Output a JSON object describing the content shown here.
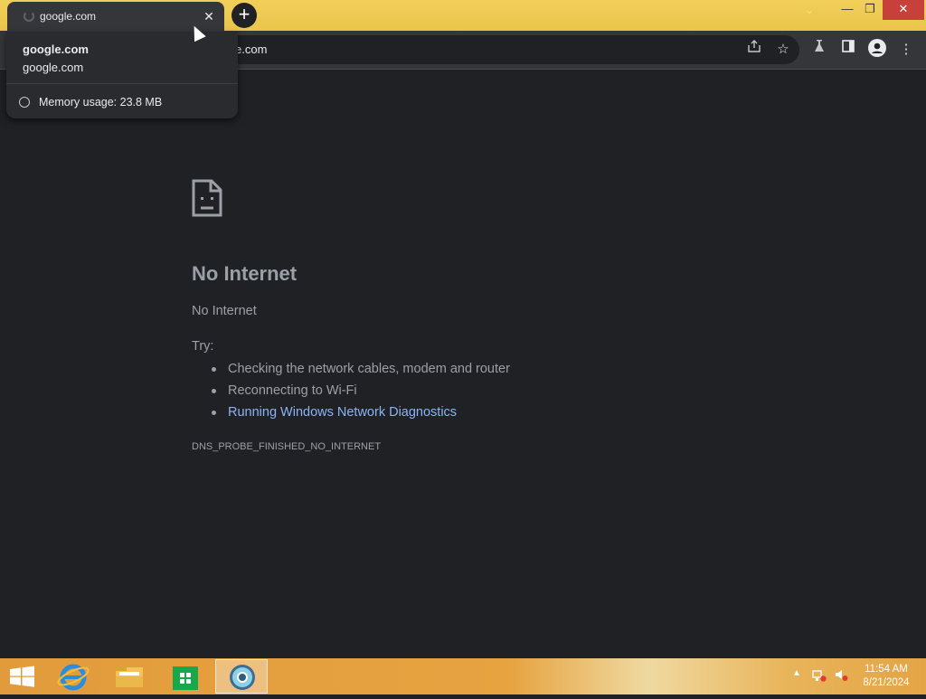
{
  "tab": {
    "title": "google.com",
    "close_label": "✕"
  },
  "newtab_label": "+",
  "window_controls": {
    "minimize": "—",
    "maximize": "❐",
    "close": "✕"
  },
  "omnibox": {
    "url_visible": "e.com"
  },
  "hovercard": {
    "title": "google.com",
    "url": "google.com",
    "memory": "Memory usage: 23.8 MB"
  },
  "toolbar_icons": [
    "share-icon",
    "star-icon",
    "extension-icon",
    "sidepanel-icon",
    "profile-icon",
    "menu-icon"
  ],
  "error_page": {
    "heading": "No Internet",
    "subtitle": "No Internet",
    "try_label": "Try:",
    "suggestions": [
      "Checking the network cables, modem and router",
      "Reconnecting to Wi-Fi",
      "Running Windows Network Diagnostics"
    ],
    "error_code": "DNS_PROBE_FINISHED_NO_INTERNET"
  },
  "taskbar": {
    "apps": [
      "start",
      "internet-explorer",
      "file-explorer",
      "store",
      "chrome"
    ],
    "clock_time": "11:54 AM",
    "clock_date": "8/21/2024"
  },
  "colors": {
    "accent": "#f0cf5a",
    "link": "#8ab4f8",
    "page_bg": "#202124"
  }
}
